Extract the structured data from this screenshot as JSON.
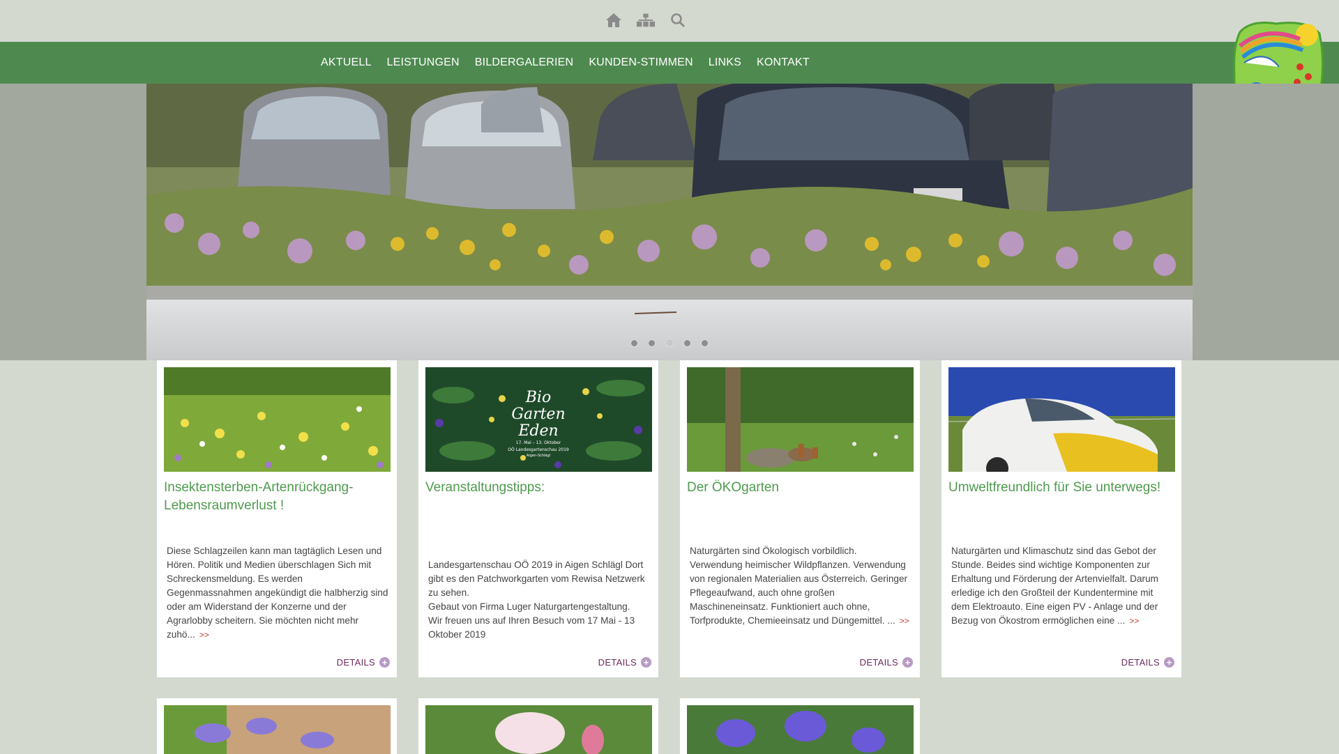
{
  "header": {
    "icons": [
      "home-icon",
      "sitemap-icon",
      "search-icon"
    ]
  },
  "nav": {
    "items": [
      "AKTUELL",
      "LEISTUNGEN",
      "BILDERGALERIEN",
      "KUNDEN-STIMMEN",
      "LINKS",
      "KONTAKT"
    ]
  },
  "slider": {
    "slide_count": 5,
    "active_index": 3
  },
  "cards": [
    {
      "title": "Insektensterben-Artenrückgang-Lebensraumverlust !",
      "text": "Diese Schlagzeilen kann man tagtäglich Lesen und Hören. Politik und Medien überschlagen Sich mit Schreckensmeldung. Es werden Gegenmassnahmen angekündigt die halbherzig sind oder am Widerstand der Konzerne und der Agrarlobby scheitern. Sie möchten nicht mehr zuhö...",
      "more": ">>",
      "details": "DETAILS"
    },
    {
      "title": "Veranstaltungstipps:",
      "text": "Landesgartenschau OÖ 2019 in Aigen Schlägl Dort gibt es den Patchworkgarten vom Rewisa Netzwerk zu sehen.\nGebaut von Firma Luger Naturgartengestaltung.\nWir freuen uns auf Ihren Besuch vom 17 Mai - 13 Oktober 2019",
      "more": "",
      "details": "DETAILS",
      "image_text": {
        "line1": "Bio",
        "line2": "Garten",
        "line3": "Eden",
        "line4": "17. Mai – 13. Oktober",
        "line5": "OÖ Landesgartenschau 2019",
        "line6": "Aigen-Schlägl"
      }
    },
    {
      "title": "Der ÖKOgarten",
      "text": "Naturgärten sind Ökologisch vorbildlich. Verwendung heimischer Wildpflanzen. Verwendung von regionalen Materialien aus Österreich. Geringer Pflegeaufwand, auch ohne großen Maschineneinsatz. Funktioniert auch ohne, Torfprodukte, Chemieeinsatz und Düngemittel. ...",
      "more": ">>",
      "details": "DETAILS"
    },
    {
      "title": "Umweltfreundlich für Sie unterwegs!",
      "text": "Naturgärten und Klimaschutz sind das Gebot der Stunde. Beides sind wichtige Komponenten zur Erhaltung und Förderung der Artenvielfalt. Darum erledige ich den Großteil der Kundentermine mit dem Elektroauto. Eine eigen PV - Anlage und der Bezug von Ökostrom ermöglichen eine ...",
      "more": ">>",
      "details": "DETAILS"
    }
  ],
  "colors": {
    "page_bg": "#d4d9d0",
    "nav_bg": "#4e8a50",
    "title_green": "#4e9a4e",
    "more_red": "#c0392b",
    "details_purple": "#6b2a5a"
  }
}
